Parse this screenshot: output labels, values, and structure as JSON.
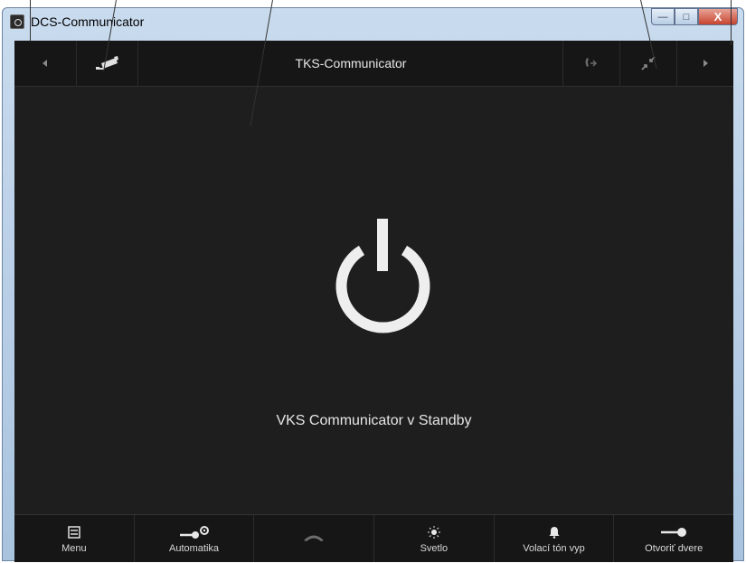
{
  "window": {
    "title": "DCS-Communicator",
    "controls": {
      "minimize": "—",
      "maximize": "□",
      "close": "X"
    }
  },
  "topbar": {
    "prev_icon": "chevron-left-icon",
    "camera_icon": "camera-icon",
    "title": "TKS-Communicator",
    "call_transfer_icon": "call-transfer-icon",
    "collapse_icon": "collapse-icon",
    "next_icon": "chevron-right-icon"
  },
  "main": {
    "power_icon": "power-icon",
    "status": "VKS Communicator v Standby"
  },
  "bottombar": {
    "buttons": [
      {
        "label": "Menu",
        "icon": "menu-icon"
      },
      {
        "label": "Automatika",
        "icon": "key-gear-icon"
      },
      {
        "label": "",
        "icon": "hangup-icon"
      },
      {
        "label": "Svetlo",
        "icon": "light-icon"
      },
      {
        "label": "Volací tón vyp",
        "icon": "bell-icon"
      },
      {
        "label": "Otvoriť dvere",
        "icon": "key-icon"
      }
    ]
  },
  "colors": {
    "background": "#1e1e1e",
    "bar": "#161616",
    "text": "#e6e6e6",
    "icon_muted": "#9a9a9a"
  }
}
